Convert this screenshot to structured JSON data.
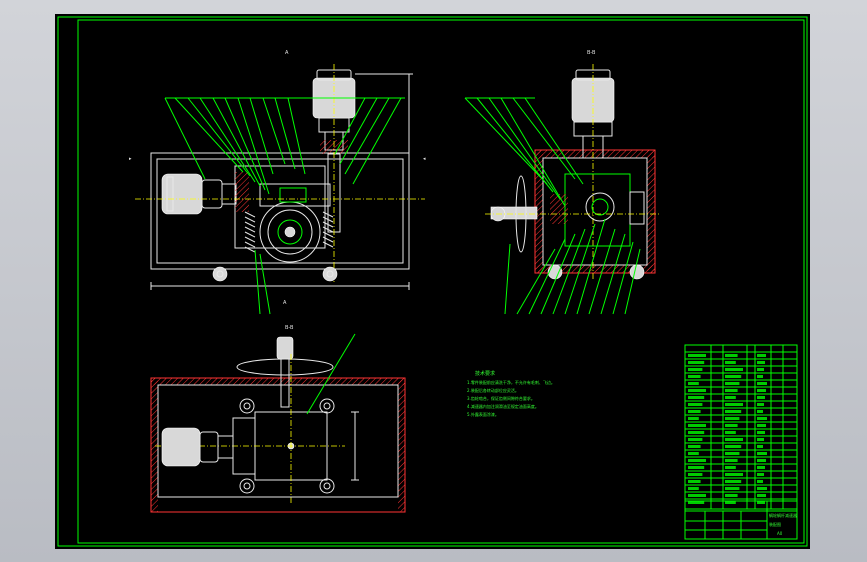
{
  "drawing": {
    "section_label_a": "A",
    "section_label_b": "B-B",
    "section_label_c": "B-B",
    "view_label": "A"
  },
  "technical_requirements": {
    "title": "技术要求",
    "items": [
      "1.零件装配前应清洗干净，不允许有毛刺、飞边。",
      "2.装配后各转动部位应灵活。",
      "3.齿轮啮合，保证齿侧间隙符合要求。",
      "4.减速器内加注润滑油至规定油面高度。",
      "5.外露表面涂漆。"
    ]
  },
  "title_block": {
    "name": "蜗轮蜗杆减速器",
    "drawing_type": "装配图",
    "code": "A0"
  },
  "colors": {
    "background": "#000000",
    "frame": "#00ff00",
    "parts": "#ffffff",
    "section": "#ff3333",
    "centerline": "#ffff00"
  }
}
